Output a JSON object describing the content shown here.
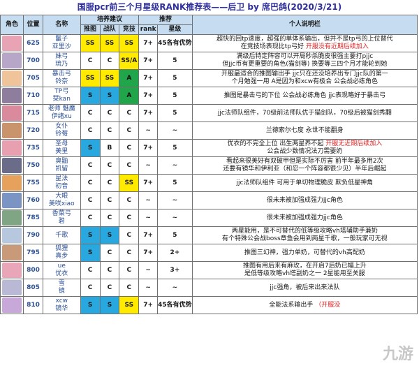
{
  "title": "国服pcr前三个月星级RANK推荐表——后卫 by 席巴鸽(2020/3/21)",
  "headers": {
    "role": "角色",
    "position": "位置",
    "name": "名称",
    "training": "培养建议",
    "recommend": "推荐",
    "notes": "个人说明栏",
    "sub_push": "推图",
    "sub_guild": "战队",
    "sub_arena": "竞技",
    "sub_rank": "rank",
    "sub_star": "星级"
  },
  "watermark": "九游",
  "rows": [
    {
      "pos": "625",
      "name": "鬣子",
      "name2": "亚里沙",
      "push": "SS",
      "guild": "SS",
      "arena": "SS",
      "rank": "7+",
      "star": "45各有优势",
      "note": "超快的回tp速度，超强的单体系输出，但并不是tp弓的上位替代",
      "note2": "在竞技场表现比tp弓好",
      "note2_red": "开服没有近期后续加入",
      "avatar_color": "#e8a3b4"
    },
    {
      "pos": "700",
      "name": "妹弓",
      "name2": "琉乃",
      "push": "C",
      "guild": "C",
      "arena": "SS/A",
      "rank": "7+",
      "star": "5",
      "note": "满级后特定阵容可以开局秒杀脆皮很强主要打pjjc",
      "note2": "但jjc币有更重要的角色(猫剑等)  换要等三四个月才能轮到她",
      "note2_red": "",
      "avatar_color": "#b8a6c9"
    },
    {
      "pos": "705",
      "name": "暴击弓",
      "name2": "铃奈",
      "push": "SS",
      "guild": "SS",
      "arena": "A",
      "rank": "7+",
      "star": "5",
      "note": "开服最适合的推图输出手 jjc只在还没培养出专门jjc队的第一",
      "note2": "个月勉强一用  A是因为和xcw有极合  公会战必练角色",
      "note2_red": "",
      "avatar_color": "#efc49a"
    },
    {
      "pos": "710",
      "name": "TP弓",
      "name2": "栞kan",
      "push": "S",
      "guild": "S",
      "arena": "A",
      "rank": "7+",
      "star": "5",
      "note": "推图是暴击弓的下位  公会战必练角色  jjc表现略好于暴击弓",
      "note2": "",
      "note2_red": "",
      "avatar_color": "#8f7d9e"
    },
    {
      "pos": "715",
      "name": "老师 魅魔",
      "name2": "伊绪xu",
      "push": "C",
      "guild": "C",
      "arena": "C",
      "rank": "7+",
      "star": "5",
      "note": "jjc法师队组件，70级前法师队优于猫剑队，70级后被猫剑秀翻",
      "note2": "",
      "note2_red": "",
      "avatar_color": "#d98a9c"
    },
    {
      "pos": "720",
      "name": "女仆",
      "name2": "铃莓",
      "push": "C",
      "guild": "C",
      "arena": "C",
      "rank": "~",
      "star": "~",
      "note": "兰德索尔七度  永世不能翻身",
      "note2": "",
      "note2_red": "",
      "avatar_color": "#c9936b"
    },
    {
      "pos": "735",
      "name": "圣母",
      "name2": "美里",
      "push": "S",
      "guild": "B",
      "arena": "C",
      "rank": "7+",
      "star": "5",
      "note": "优衣的不完全上位 出生两星养不起",
      "note_red": "开服无近期后续加入",
      "note2": "公会战少数情况法刀需要奶",
      "note2_red": "",
      "avatar_color": "#e89fb0"
    },
    {
      "pos": "750",
      "name": "臭鼬",
      "name2": "凯留",
      "push": "C",
      "guild": "C",
      "arena": "C",
      "rank": "~",
      "star": "~",
      "note": "看起来很美好有双破甲但是实际不厉害     前半年最多用2次",
      "note2": "还要有镜华和伊利亚（和忍一个阵容都很少见）半年后崛起",
      "note2_red": "",
      "avatar_color": "#6b6b8a"
    },
    {
      "pos": "755",
      "name": "星法",
      "name2": "初音",
      "push": "C",
      "guild": "C",
      "arena": "SS",
      "rank": "7+",
      "star": "5",
      "note": "jjc法师队组件  可用于单切物理脆皮  欺负低星神角",
      "note2": "",
      "note2_red": "",
      "avatar_color": "#e6a15c"
    },
    {
      "pos": "760",
      "name": "大眼",
      "name2": "美咲xiao",
      "push": "C",
      "guild": "C",
      "arena": "C",
      "rank": "~",
      "star": "~",
      "note": "很未来被加强成强力jjc角色",
      "note2": "",
      "note2_red": "",
      "avatar_color": "#7a94c4"
    },
    {
      "pos": "785",
      "name": "香菜弓",
      "name2": "碧",
      "push": "C",
      "guild": "C",
      "arena": "C",
      "rank": "~",
      "star": "~",
      "note": "很未来被加强成强力jjc角色",
      "note2": "",
      "note2_red": "",
      "avatar_color": "#7fa584"
    },
    {
      "pos": "790",
      "name": "千歌",
      "name2": "",
      "push": "S",
      "guild": "S",
      "arena": "C",
      "rank": "7+",
      "star": "5",
      "note": "两星能用，是不可替代的低等级攻略vh塔辅助手兼奶",
      "note2": "有个特殊公会战boss章鱼会用到两星千歌，一般玩家可无视",
      "note2_red": "",
      "avatar_color": "#b7c7dd"
    },
    {
      "pos": "795",
      "name": "狐狸",
      "name2": "真步",
      "push": "S",
      "guild": "C",
      "arena": "C",
      "rank": "7+",
      "star": "2+",
      "note": "推图三幻神，强力单奶，可替代的vh高配奶",
      "note2": "",
      "note2_red": "",
      "avatar_color": "#c99a7a"
    },
    {
      "pos": "800",
      "name": "ue",
      "name2": "优衣",
      "push": "C",
      "guild": "C",
      "arena": "C",
      "rank": "~",
      "star": "3+",
      "note": "推图有用后来有麻玫，在开启7后奶已幅上升",
      "note2": "是低等级攻略vh塔副奶之一   2星能用至关服",
      "note2_red": "",
      "avatar_color": "#e8a6b8"
    },
    {
      "pos": "805",
      "name": "雪",
      "name2": "镜",
      "push": "C",
      "guild": "C",
      "arena": "C",
      "rank": "~",
      "star": "~",
      "note": "jjc强角，被后来出来法队",
      "note2": "",
      "note2_red": "",
      "avatar_color": "#b9b9d6"
    },
    {
      "pos": "810",
      "name": "xcw",
      "name2": "镜华",
      "push": "S",
      "guild": "S",
      "arena": "SS",
      "rank": "7+",
      "star": "45各有优势",
      "note": "全能法系输出手",
      "note_red": "（开服没",
      "note2": "",
      "note2_red": "",
      "avatar_color": "#c7a8d8"
    }
  ]
}
